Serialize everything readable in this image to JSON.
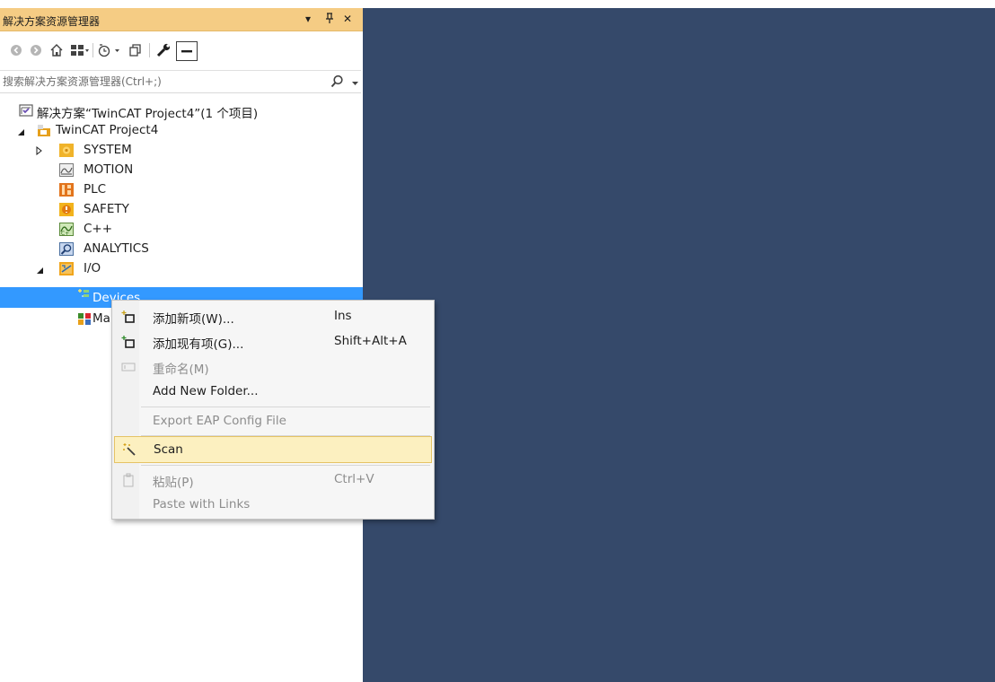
{
  "panel": {
    "title": "解决方案资源管理器",
    "dropdown_glyph": "▾",
    "pin_glyph": "ꟼ",
    "close_glyph": "✕"
  },
  "search": {
    "placeholder": "搜索解决方案资源管理器(Ctrl+;)"
  },
  "tree": {
    "solution_label": "解决方案“TwinCAT Project4”(1 个项目)",
    "project_label": "TwinCAT Project4",
    "items": [
      {
        "label": "SYSTEM",
        "icon": "system-icon"
      },
      {
        "label": "MOTION",
        "icon": "motion-icon"
      },
      {
        "label": "PLC",
        "icon": "plc-icon"
      },
      {
        "label": "SAFETY",
        "icon": "safety-icon"
      },
      {
        "label": "C++",
        "icon": "cpp-icon"
      },
      {
        "label": "ANALYTICS",
        "icon": "analytics-icon"
      },
      {
        "label": "I/O",
        "icon": "io-icon"
      }
    ],
    "io_children": [
      {
        "label": "Devices",
        "icon": "devices-icon",
        "selected": true
      },
      {
        "label": "Mappings",
        "icon": "mappings-icon"
      }
    ]
  },
  "context_menu": {
    "items": [
      {
        "label": "添加新项(W)...",
        "shortcut": "Ins",
        "icon": "add-new-item-icon",
        "enabled": true
      },
      {
        "label": "添加现有项(G)...",
        "shortcut": "Shift+Alt+A",
        "icon": "add-existing-item-icon",
        "enabled": true
      },
      {
        "label": "重命名(M)",
        "shortcut": "",
        "icon": "rename-icon",
        "enabled": false
      },
      {
        "label": "Add New Folder...",
        "shortcut": "",
        "icon": "",
        "enabled": true
      },
      {
        "label": "Export EAP Config File",
        "shortcut": "",
        "icon": "",
        "enabled": false
      },
      {
        "label": "Scan",
        "shortcut": "",
        "icon": "scan-wand-icon",
        "enabled": true,
        "highlighted": true
      },
      {
        "label": "粘贴(P)",
        "shortcut": "Ctrl+V",
        "icon": "paste-icon",
        "enabled": false
      },
      {
        "label": "Paste with Links",
        "shortcut": "",
        "icon": "",
        "enabled": false
      }
    ]
  },
  "colors": {
    "title_bar": "#f5cc84",
    "selection": "#3399ff",
    "menu_highlight": "#fcf0c0",
    "editor_background": "#35496a"
  }
}
